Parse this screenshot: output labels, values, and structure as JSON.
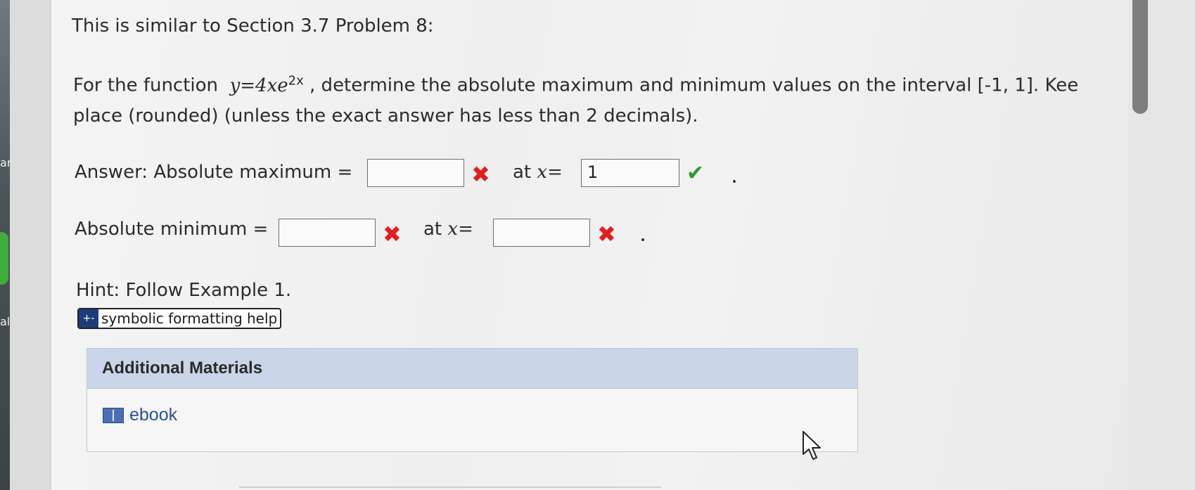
{
  "edge": {
    "frag1": "ar",
    "frag2": "al"
  },
  "problem": {
    "title": "This is similar to Section 3.7 Problem 8:",
    "line1_prefix": "For the function",
    "function_base": "y=4xe",
    "function_exponent": "2x",
    "line1_suffix": ", determine the absolute maximum and minimum values on the interval [-1, 1]. Kee",
    "line2": "place (rounded) (unless the exact answer has less than 2 decimals)."
  },
  "answers": {
    "max_label": "Answer: Absolute maximum =",
    "max_value": "",
    "max_at_label": "at",
    "x_var": "x=",
    "max_x_value": "1",
    "min_label": "Absolute minimum =",
    "min_value": "",
    "min_at_label": "at",
    "min_x_value": "",
    "wrong_mark": "✖",
    "correct_mark": "✔"
  },
  "hint": {
    "text": "Hint: Follow Example 1."
  },
  "help_button": {
    "icon_glyph": "+-",
    "label": "symbolic formatting help"
  },
  "materials": {
    "header": "Additional Materials",
    "ebook_label": "ebook"
  },
  "colors": {
    "wrong": "#e02020",
    "correct": "#2c9a2c",
    "materials_header": "#c9d5e8",
    "link": "#2b4f9a"
  }
}
